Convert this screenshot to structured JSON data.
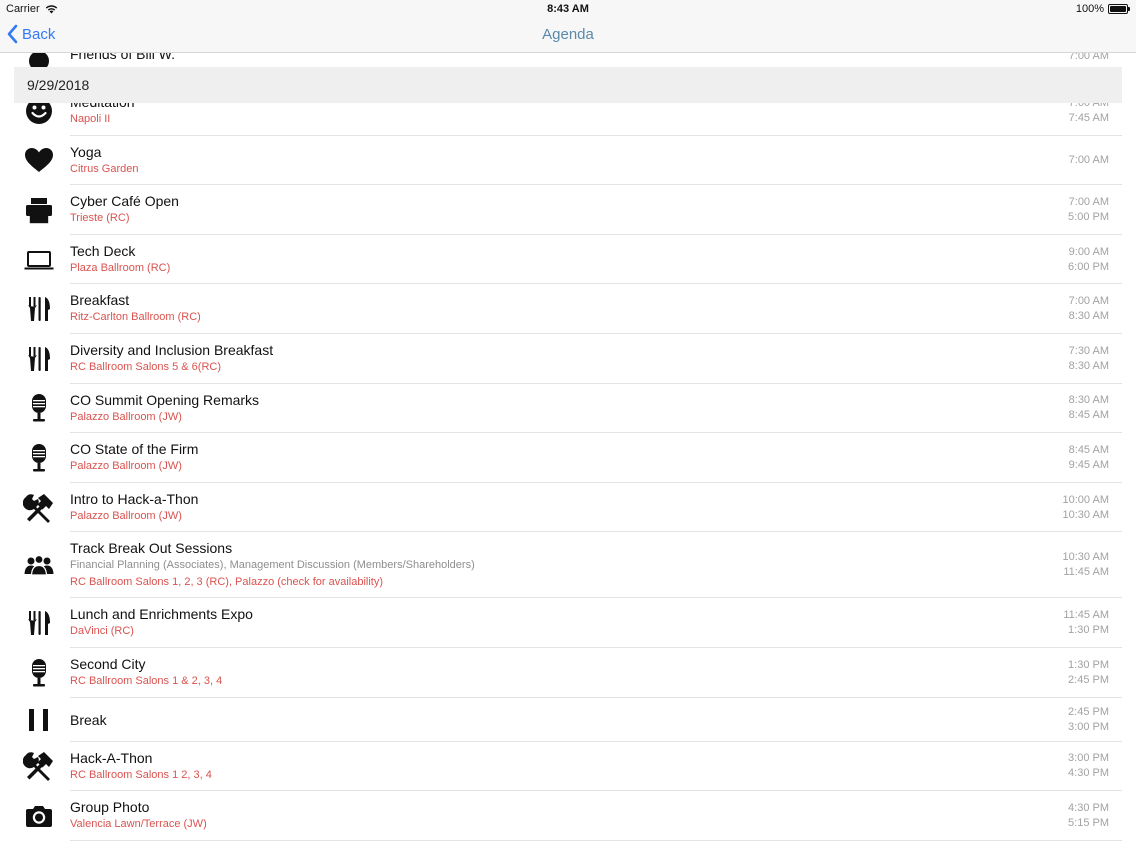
{
  "status": {
    "carrier": "Carrier",
    "time": "8:43 AM",
    "battery": "100%",
    "battery_level": 1.0
  },
  "nav": {
    "back_label": "Back",
    "title": "Agenda"
  },
  "date_header": "9/29/2018",
  "partial_top": {
    "title": "Friends of Bill W.",
    "start": "7:00 AM"
  },
  "events": [
    {
      "title": "Meditation",
      "location": "Napoli II",
      "start": "7:00 AM",
      "end": "7:45 AM",
      "icon": "smiley-face-icon"
    },
    {
      "title": "Yoga",
      "location": "Citrus Garden",
      "start": "7:00 AM",
      "end": "",
      "icon": "heart-icon"
    },
    {
      "title": "Cyber Café Open",
      "location": "Trieste (RC)",
      "start": "7:00 AM",
      "end": "5:00 PM",
      "icon": "printer-icon"
    },
    {
      "title": "Tech Deck",
      "location": "Plaza Ballroom (RC)",
      "start": "9:00 AM",
      "end": "6:00 PM",
      "icon": "laptop-icon"
    },
    {
      "title": "Breakfast",
      "location": "Ritz-Carlton Ballroom (RC)",
      "start": "7:00 AM",
      "end": "8:30 AM",
      "icon": "fork-knife-icon"
    },
    {
      "title": "Diversity and Inclusion Breakfast",
      "location": "RC Ballroom Salons 5 & 6(RC)",
      "start": "7:30 AM",
      "end": "8:30 AM",
      "icon": "fork-knife-icon"
    },
    {
      "title": "CO Summit Opening Remarks",
      "location": "Palazzo Ballroom (JW)",
      "start": "8:30 AM",
      "end": "8:45 AM",
      "icon": "microphone-icon"
    },
    {
      "title": "CO State of the Firm",
      "location": "Palazzo Ballroom (JW)",
      "start": "8:45 AM",
      "end": "9:45 AM",
      "icon": "microphone-icon"
    },
    {
      "title": "Intro to Hack-a-Thon",
      "location": "Palazzo Ballroom (JW)",
      "start": "10:00 AM",
      "end": "10:30 AM",
      "icon": "hammer-wrench-icon"
    },
    {
      "title": "Track Break Out Sessions",
      "description": "Financial Planning (Associates), Management Discussion (Members/Shareholders)",
      "location": "RC Ballroom Salons 1, 2, 3 (RC), Palazzo (check for availability)",
      "start": "10:30 AM",
      "end": "11:45 AM",
      "icon": "people-icon"
    },
    {
      "title": "Lunch and Enrichments Expo",
      "location": "DaVinci (RC)",
      "start": "11:45 AM",
      "end": "1:30 PM",
      "icon": "fork-knife-icon"
    },
    {
      "title": "Second City",
      "location": "RC Ballroom Salons 1 & 2, 3, 4",
      "start": "1:30 PM",
      "end": "2:45 PM",
      "icon": "microphone-icon"
    },
    {
      "title": "Break",
      "location": "",
      "start": "2:45 PM",
      "end": "3:00 PM",
      "icon": "pause-icon"
    },
    {
      "title": "Hack-A-Thon",
      "location": "RC Ballroom Salons 1 2, 3, 4",
      "start": "3:00 PM",
      "end": "4:30 PM",
      "icon": "hammer-wrench-icon"
    },
    {
      "title": "Group Photo",
      "location": "Valencia Lawn/Terrace (JW)",
      "start": "4:30 PM",
      "end": "5:15 PM",
      "icon": "camera-icon"
    }
  ]
}
